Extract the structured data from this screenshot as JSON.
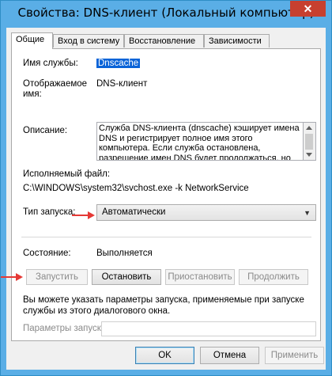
{
  "window": {
    "title": "Свойства: DNS-клиент (Локальный компьютер)",
    "close_glyph": "✕"
  },
  "tabs": [
    {
      "label": "Общие",
      "active": true
    },
    {
      "label": "Вход в систему",
      "active": false
    },
    {
      "label": "Восстановление",
      "active": false
    },
    {
      "label": "Зависимости",
      "active": false
    }
  ],
  "general": {
    "service_name_label": "Имя службы:",
    "service_name_value": "Dnscache",
    "display_name_label": "Отображаемое имя:",
    "display_name_value": "DNS-клиент",
    "description_label": "Описание:",
    "description_value": "Служба DNS-клиента (dnscache) кэширует имена DNS и регистрирует полное имя этого компьютера. Если служба остановлена, разрешение имен DNS будет продолжаться, но",
    "exe_label": "Исполняемый файл:",
    "exe_value": "C:\\WINDOWS\\system32\\svchost.exe -k NetworkService",
    "startup_type_label": "Тип запуска:",
    "startup_type_value": "Автоматически",
    "status_label": "Состояние:",
    "status_value": "Выполняется",
    "start_params_hint": "Вы можете указать параметры запуска, применяемые при запуске службы из этого диалогового окна.",
    "start_params_label": "Параметры запуска:",
    "start_params_value": ""
  },
  "service_buttons": {
    "start": "Запустить",
    "stop": "Остановить",
    "pause": "Приостановить",
    "resume": "Продолжить"
  },
  "dialog_buttons": {
    "ok": "OK",
    "cancel": "Отмена",
    "apply": "Применить"
  },
  "colors": {
    "title_bar": "#5aaee6",
    "close_button": "#c7402f",
    "selection": "#0a64d8",
    "annotation_arrow": "#e53935"
  },
  "icons": {
    "close": "close-icon",
    "dropdown": "chevron-down-icon",
    "scroll_up": "scroll-up-icon",
    "scroll_down": "scroll-down-icon"
  }
}
